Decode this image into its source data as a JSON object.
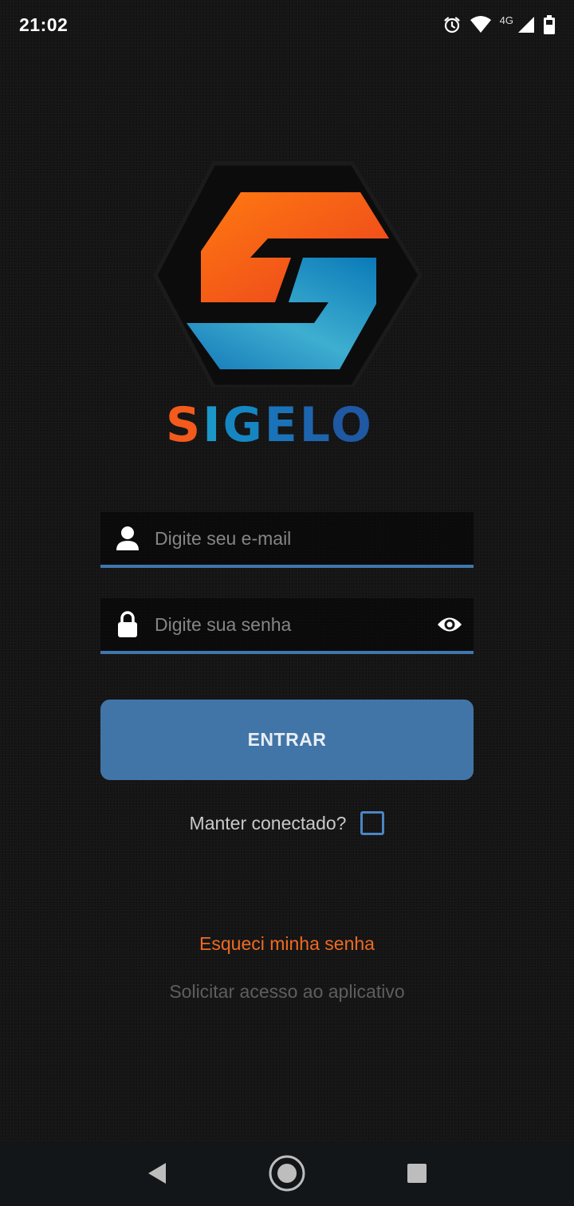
{
  "status_bar": {
    "time": "21:02",
    "network_label": "4G",
    "icons": [
      "alarm-icon",
      "wifi-icon",
      "cell-signal-icon",
      "battery-icon"
    ]
  },
  "brand": {
    "name_letters": [
      "S",
      "I",
      "G",
      "E",
      "L",
      "O"
    ],
    "colors": {
      "orange": "#f35a1c",
      "blue": "#1b97c9",
      "dark_blue": "#1f58a3"
    }
  },
  "form": {
    "email": {
      "placeholder": "Digite seu e-mail",
      "value": "",
      "icon": "user-icon"
    },
    "password": {
      "placeholder": "Digite sua senha",
      "value": "",
      "icon": "lock-icon",
      "toggle_icon": "eye-icon"
    },
    "submit_label": "ENTRAR",
    "keep_connected_label": "Manter conectado?",
    "keep_connected_checked": false
  },
  "links": {
    "forgot_password": "Esqueci minha senha",
    "request_access": "Solicitar acesso ao aplicativo"
  },
  "colors": {
    "accent": "#4275a7",
    "link_orange": "#f06a22",
    "background": "#151515"
  },
  "nav_bar": {
    "buttons": [
      "back-icon",
      "home-icon",
      "recents-icon"
    ]
  }
}
